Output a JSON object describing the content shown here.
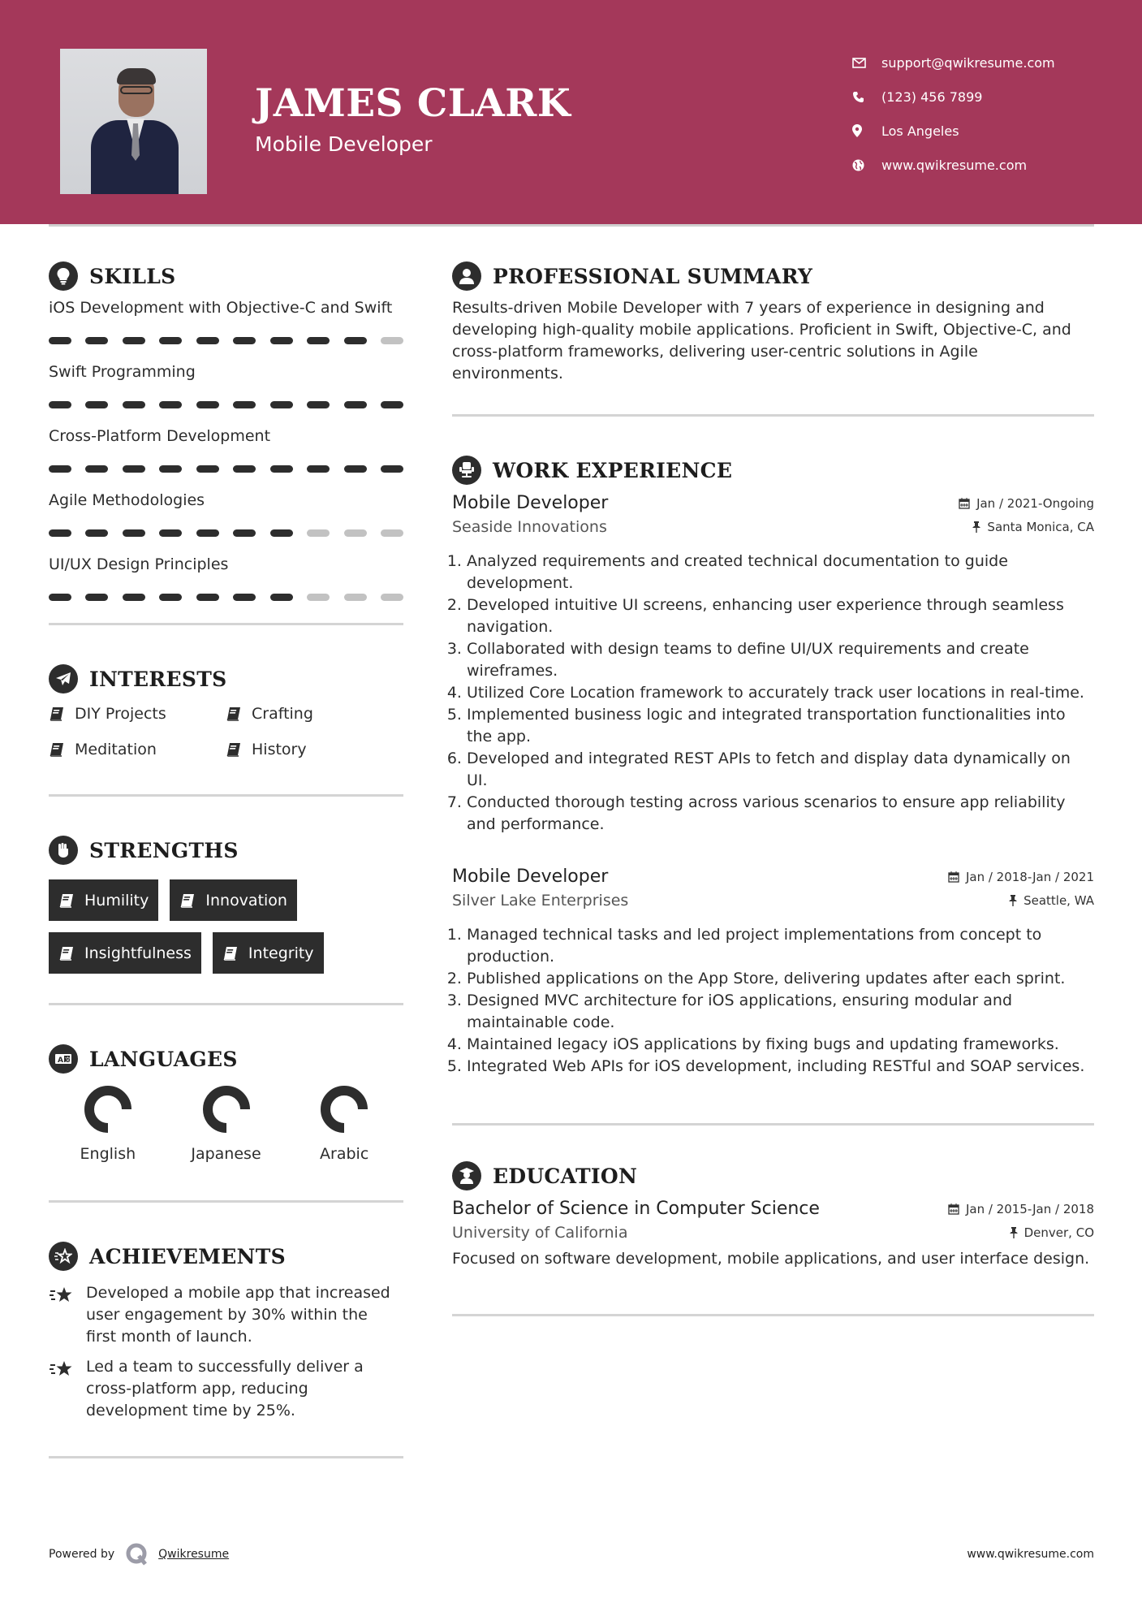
{
  "header": {
    "name": "JAMES CLARK",
    "role": "Mobile Developer",
    "background_color": "#a4385a",
    "contacts": [
      {
        "icon": "envelope-icon",
        "text": "support@qwikresume.com"
      },
      {
        "icon": "phone-icon",
        "text": "(123) 456 7899"
      },
      {
        "icon": "map-pin-icon",
        "text": "Los Angeles"
      },
      {
        "icon": "globe-icon",
        "text": "www.qwikresume.com"
      }
    ]
  },
  "skills": {
    "title": "SKILLS",
    "icon": "lightbulb-icon",
    "items": [
      {
        "name": "iOS Development with Objective-C and Swift",
        "level": 9,
        "max": 10
      },
      {
        "name": "Swift Programming",
        "level": 10,
        "max": 10
      },
      {
        "name": "Cross-Platform Development",
        "level": 10,
        "max": 10
      },
      {
        "name": "Agile Methodologies",
        "level": 7,
        "max": 10
      },
      {
        "name": "UI/UX Design Principles",
        "level": 7,
        "max": 10
      }
    ]
  },
  "interests": {
    "title": "INTERESTS",
    "icon": "paper-plane-icon",
    "items": [
      "DIY Projects",
      "Crafting",
      "Meditation",
      "History"
    ]
  },
  "strengths": {
    "title": "STRENGTHS",
    "icon": "raised-fist-icon",
    "items": [
      "Humility",
      "Innovation",
      "Insightfulness",
      "Integrity"
    ]
  },
  "languages": {
    "title": "LANGUAGES",
    "icon": "translate-icon",
    "items": [
      {
        "name": "English",
        "proficiency": 0.75
      },
      {
        "name": "Japanese",
        "proficiency": 0.75
      },
      {
        "name": "Arabic",
        "proficiency": 0.75
      }
    ]
  },
  "achievements": {
    "title": "ACHIEVEMENTS",
    "icon": "star-badge-icon",
    "items": [
      "Developed a mobile app that increased user engagement by 30% within the first month of launch.",
      "Led a team to successfully deliver a cross-platform app, reducing development time by 25%."
    ]
  },
  "summary": {
    "title": "PROFESSIONAL SUMMARY",
    "icon": "user-icon",
    "text": "Results-driven Mobile Developer with 7 years of experience in designing and developing high-quality mobile applications. Proficient in Swift, Objective-C, and cross-platform frameworks, delivering user-centric solutions in Agile environments."
  },
  "experience": {
    "title": "WORK EXPERIENCE",
    "icon": "office-chair-icon",
    "jobs": [
      {
        "title": "Mobile Developer",
        "company": "Seaside Innovations",
        "dates": "Jan / 2021-Ongoing",
        "location": "Santa Monica, CA",
        "duties": [
          "Analyzed requirements and created technical documentation to guide development.",
          "Developed intuitive UI screens, enhancing user experience through seamless navigation.",
          "Collaborated with design teams to define UI/UX requirements and create wireframes.",
          "Utilized Core Location framework to accurately track user locations in real-time.",
          "Implemented business logic and integrated transportation functionalities into the app.",
          "Developed and integrated REST APIs to fetch and display data dynamically on UI.",
          "Conducted thorough testing across various scenarios to ensure app reliability and performance."
        ]
      },
      {
        "title": "Mobile Developer",
        "company": "Silver Lake Enterprises",
        "dates": "Jan / 2018-Jan / 2021",
        "location": "Seattle, WA",
        "duties": [
          "Managed technical tasks and led project implementations from concept to production.",
          "Published applications on the App Store, delivering updates after each sprint.",
          "Designed MVC architecture for iOS applications, ensuring modular and maintainable code.",
          "Maintained legacy iOS applications by fixing bugs and updating frameworks.",
          "Integrated Web APIs for iOS development, including RESTful and SOAP services."
        ]
      }
    ]
  },
  "education": {
    "title": "EDUCATION",
    "icon": "graduate-icon",
    "degree": "Bachelor of Science in Computer Science",
    "school": "University of California",
    "dates": "Jan / 2015-Jan / 2018",
    "location": "Denver, CO",
    "description": "Focused on software development, mobile applications, and user interface design."
  },
  "footer": {
    "powered_by": "Powered by",
    "brand_link": "Qwikresume",
    "website": "www.qwikresume.com"
  }
}
